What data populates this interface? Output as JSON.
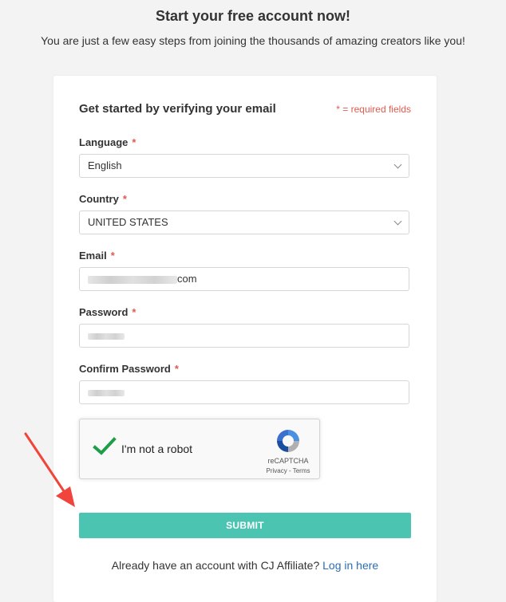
{
  "header": {
    "title": "Start your free account now!",
    "subtitle": "You are just a few easy steps from joining the thousands of amazing creators like you!"
  },
  "form": {
    "heading": "Get started by verifying your email",
    "required_note": "* = required fields",
    "language": {
      "label": "Language",
      "value": "English"
    },
    "country": {
      "label": "Country",
      "value": "UNITED STATES"
    },
    "email": {
      "label": "Email",
      "value_suffix": "com"
    },
    "password": {
      "label": "Password"
    },
    "confirm_password": {
      "label": "Confirm Password"
    },
    "required_mark": "*"
  },
  "recaptcha": {
    "label": "I'm not a robot",
    "brand": "reCAPTCHA",
    "privacy": "Privacy",
    "separator": " - ",
    "terms": "Terms"
  },
  "submit_label": "SUBMIT",
  "login": {
    "prompt": "Already have an account with CJ Affiliate?",
    "link": "Log in here"
  },
  "colors": {
    "accent": "#4cc4b2",
    "required": "#e05a4f",
    "link": "#2a6db5",
    "check": "#1e9e4a",
    "annotation_arrow": "#f0443c"
  }
}
